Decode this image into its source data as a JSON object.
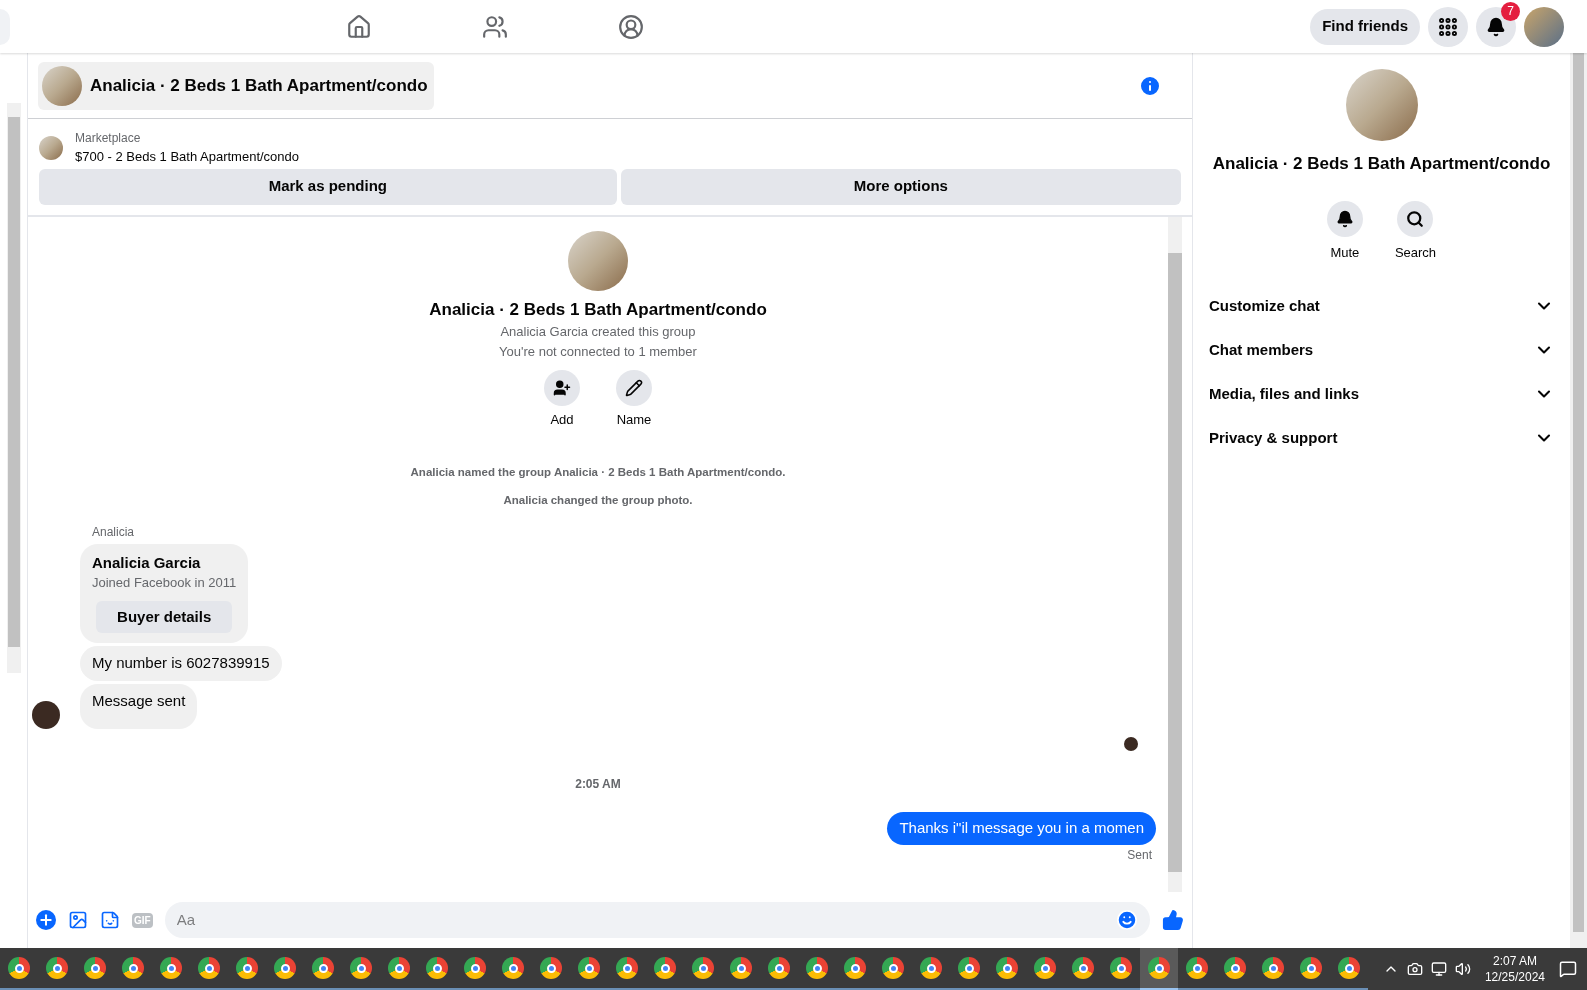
{
  "top_nav": {
    "find_friends": "Find friends",
    "notification_count": "7"
  },
  "chat_header": {
    "title": "Analicia · 2 Beds 1 Bath Apartment/condo"
  },
  "listing": {
    "source": "Marketplace",
    "title": "$700 - 2 Beds 1 Bath Apartment/condo",
    "actions": [
      "Mark as pending",
      "More options"
    ]
  },
  "intro": {
    "title": "Analicia · 2 Beds 1 Bath Apartment/condo",
    "lines": [
      "Analicia Garcia created this group",
      "You're not connected to 1 member"
    ],
    "actions": [
      {
        "kind": "add",
        "label": "Add"
      },
      {
        "kind": "name",
        "label": "Name"
      }
    ]
  },
  "events": [
    "Analicia named the group Analicia · 2 Beds 1 Bath Apartment/condo.",
    "Analicia changed the group photo."
  ],
  "incoming": {
    "sender": "Analicia",
    "card": {
      "name": "Analicia Garcia",
      "subtitle": "Joined Facebook in 2011",
      "button": "Buyer details"
    },
    "messages": [
      "My number is 6027839915",
      "Message sent"
    ]
  },
  "timestamp": "2:05 AM",
  "outgoing": {
    "text": "Thanks i\"il message you in a momen",
    "status": "Sent"
  },
  "composer": {
    "gif": "GIF",
    "placeholder": "Aa"
  },
  "info_panel": {
    "title": "Analicia · 2 Beds 1 Bath Apartment/condo",
    "actions": [
      {
        "kind": "mute",
        "label": "Mute"
      },
      {
        "kind": "search",
        "label": "Search"
      }
    ],
    "sections": [
      {
        "label": "Customize chat",
        "expanded": false
      },
      {
        "label": "Chat members",
        "expanded": false
      },
      {
        "label": "Media, files and links",
        "expanded": false
      },
      {
        "label": "Privacy & support",
        "expanded": false
      }
    ]
  },
  "taskbar": {
    "apps": [
      {
        "selected": false
      },
      {
        "selected": false
      },
      {
        "selected": false
      },
      {
        "selected": false
      },
      {
        "selected": false
      },
      {
        "selected": false
      },
      {
        "selected": false
      },
      {
        "selected": false
      },
      {
        "selected": false
      },
      {
        "selected": false
      },
      {
        "selected": false
      },
      {
        "selected": false
      },
      {
        "selected": false
      },
      {
        "selected": false
      },
      {
        "selected": false
      },
      {
        "selected": false
      },
      {
        "selected": false
      },
      {
        "selected": false
      },
      {
        "selected": false
      },
      {
        "selected": false
      },
      {
        "selected": false
      },
      {
        "selected": false
      },
      {
        "selected": false
      },
      {
        "selected": false
      },
      {
        "selected": false
      },
      {
        "selected": false
      },
      {
        "selected": false
      },
      {
        "selected": false
      },
      {
        "selected": false
      },
      {
        "selected": false
      },
      {
        "selected": true
      },
      {
        "selected": false
      },
      {
        "selected": false
      },
      {
        "selected": false
      },
      {
        "selected": false
      },
      {
        "selected": false
      }
    ],
    "time": "2:07 AM",
    "date": "12/25/2024"
  }
}
